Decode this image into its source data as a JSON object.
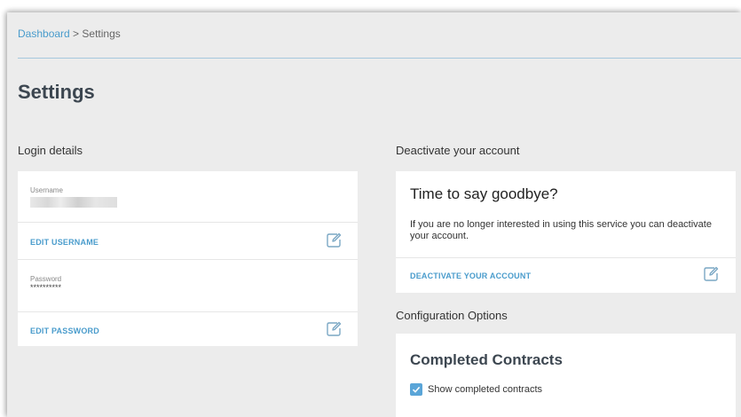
{
  "breadcrumb": {
    "root": "Dashboard",
    "separator": " > ",
    "current": "Settings"
  },
  "page": {
    "title": "Settings"
  },
  "login": {
    "section_label": "Login details",
    "username_label": "Username",
    "edit_username": "EDIT USERNAME",
    "password_label": "Password",
    "password_value": "**********",
    "edit_password": "EDIT PASSWORD"
  },
  "deactivate": {
    "section_label": "Deactivate your account",
    "heading": "Time to say goodbye?",
    "text": "If you are no longer interested in using this service you can deactivate your account.",
    "action": "DEACTIVATE YOUR ACCOUNT"
  },
  "config": {
    "section_label": "Configuration Options",
    "heading": "Completed Contracts",
    "checkbox_label": "Show completed contracts",
    "checkbox_checked": true
  },
  "colors": {
    "accent": "#4a9ccc",
    "checkbox": "#5aa5d8",
    "background": "#ececec"
  },
  "icons": {
    "edit": "edit-icon",
    "check": "check-icon"
  }
}
